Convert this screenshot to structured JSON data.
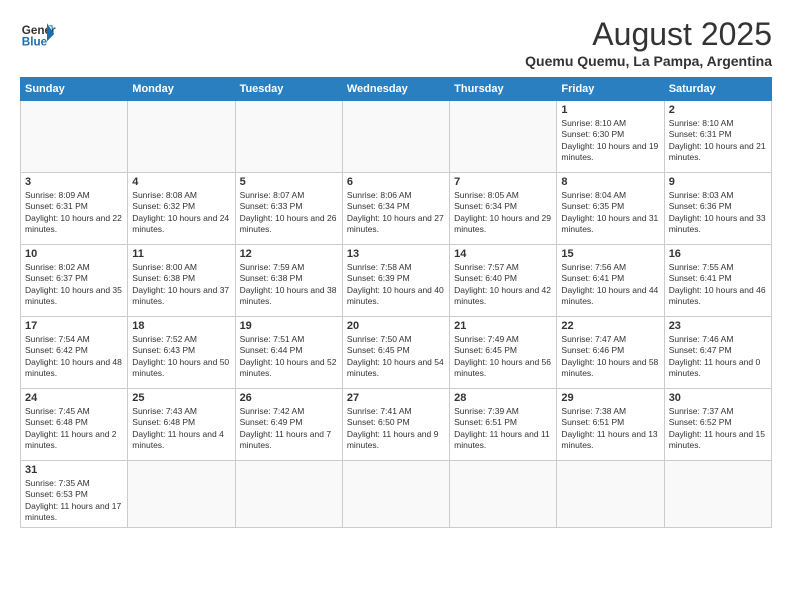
{
  "logo": {
    "text_general": "General",
    "text_blue": "Blue"
  },
  "title": {
    "month_year": "August 2025",
    "location": "Quemu Quemu, La Pampa, Argentina"
  },
  "weekdays": [
    "Sunday",
    "Monday",
    "Tuesday",
    "Wednesday",
    "Thursday",
    "Friday",
    "Saturday"
  ],
  "weeks": [
    [
      {
        "day": "",
        "info": ""
      },
      {
        "day": "",
        "info": ""
      },
      {
        "day": "",
        "info": ""
      },
      {
        "day": "",
        "info": ""
      },
      {
        "day": "",
        "info": ""
      },
      {
        "day": "1",
        "info": "Sunrise: 8:10 AM\nSunset: 6:30 PM\nDaylight: 10 hours and 19 minutes."
      },
      {
        "day": "2",
        "info": "Sunrise: 8:10 AM\nSunset: 6:31 PM\nDaylight: 10 hours and 21 minutes."
      }
    ],
    [
      {
        "day": "3",
        "info": "Sunrise: 8:09 AM\nSunset: 6:31 PM\nDaylight: 10 hours and 22 minutes."
      },
      {
        "day": "4",
        "info": "Sunrise: 8:08 AM\nSunset: 6:32 PM\nDaylight: 10 hours and 24 minutes."
      },
      {
        "day": "5",
        "info": "Sunrise: 8:07 AM\nSunset: 6:33 PM\nDaylight: 10 hours and 26 minutes."
      },
      {
        "day": "6",
        "info": "Sunrise: 8:06 AM\nSunset: 6:34 PM\nDaylight: 10 hours and 27 minutes."
      },
      {
        "day": "7",
        "info": "Sunrise: 8:05 AM\nSunset: 6:34 PM\nDaylight: 10 hours and 29 minutes."
      },
      {
        "day": "8",
        "info": "Sunrise: 8:04 AM\nSunset: 6:35 PM\nDaylight: 10 hours and 31 minutes."
      },
      {
        "day": "9",
        "info": "Sunrise: 8:03 AM\nSunset: 6:36 PM\nDaylight: 10 hours and 33 minutes."
      }
    ],
    [
      {
        "day": "10",
        "info": "Sunrise: 8:02 AM\nSunset: 6:37 PM\nDaylight: 10 hours and 35 minutes."
      },
      {
        "day": "11",
        "info": "Sunrise: 8:00 AM\nSunset: 6:38 PM\nDaylight: 10 hours and 37 minutes."
      },
      {
        "day": "12",
        "info": "Sunrise: 7:59 AM\nSunset: 6:38 PM\nDaylight: 10 hours and 38 minutes."
      },
      {
        "day": "13",
        "info": "Sunrise: 7:58 AM\nSunset: 6:39 PM\nDaylight: 10 hours and 40 minutes."
      },
      {
        "day": "14",
        "info": "Sunrise: 7:57 AM\nSunset: 6:40 PM\nDaylight: 10 hours and 42 minutes."
      },
      {
        "day": "15",
        "info": "Sunrise: 7:56 AM\nSunset: 6:41 PM\nDaylight: 10 hours and 44 minutes."
      },
      {
        "day": "16",
        "info": "Sunrise: 7:55 AM\nSunset: 6:41 PM\nDaylight: 10 hours and 46 minutes."
      }
    ],
    [
      {
        "day": "17",
        "info": "Sunrise: 7:54 AM\nSunset: 6:42 PM\nDaylight: 10 hours and 48 minutes."
      },
      {
        "day": "18",
        "info": "Sunrise: 7:52 AM\nSunset: 6:43 PM\nDaylight: 10 hours and 50 minutes."
      },
      {
        "day": "19",
        "info": "Sunrise: 7:51 AM\nSunset: 6:44 PM\nDaylight: 10 hours and 52 minutes."
      },
      {
        "day": "20",
        "info": "Sunrise: 7:50 AM\nSunset: 6:45 PM\nDaylight: 10 hours and 54 minutes."
      },
      {
        "day": "21",
        "info": "Sunrise: 7:49 AM\nSunset: 6:45 PM\nDaylight: 10 hours and 56 minutes."
      },
      {
        "day": "22",
        "info": "Sunrise: 7:47 AM\nSunset: 6:46 PM\nDaylight: 10 hours and 58 minutes."
      },
      {
        "day": "23",
        "info": "Sunrise: 7:46 AM\nSunset: 6:47 PM\nDaylight: 11 hours and 0 minutes."
      }
    ],
    [
      {
        "day": "24",
        "info": "Sunrise: 7:45 AM\nSunset: 6:48 PM\nDaylight: 11 hours and 2 minutes."
      },
      {
        "day": "25",
        "info": "Sunrise: 7:43 AM\nSunset: 6:48 PM\nDaylight: 11 hours and 4 minutes."
      },
      {
        "day": "26",
        "info": "Sunrise: 7:42 AM\nSunset: 6:49 PM\nDaylight: 11 hours and 7 minutes."
      },
      {
        "day": "27",
        "info": "Sunrise: 7:41 AM\nSunset: 6:50 PM\nDaylight: 11 hours and 9 minutes."
      },
      {
        "day": "28",
        "info": "Sunrise: 7:39 AM\nSunset: 6:51 PM\nDaylight: 11 hours and 11 minutes."
      },
      {
        "day": "29",
        "info": "Sunrise: 7:38 AM\nSunset: 6:51 PM\nDaylight: 11 hours and 13 minutes."
      },
      {
        "day": "30",
        "info": "Sunrise: 7:37 AM\nSunset: 6:52 PM\nDaylight: 11 hours and 15 minutes."
      }
    ],
    [
      {
        "day": "31",
        "info": "Sunrise: 7:35 AM\nSunset: 6:53 PM\nDaylight: 11 hours and 17 minutes."
      },
      {
        "day": "",
        "info": ""
      },
      {
        "day": "",
        "info": ""
      },
      {
        "day": "",
        "info": ""
      },
      {
        "day": "",
        "info": ""
      },
      {
        "day": "",
        "info": ""
      },
      {
        "day": "",
        "info": ""
      }
    ]
  ]
}
